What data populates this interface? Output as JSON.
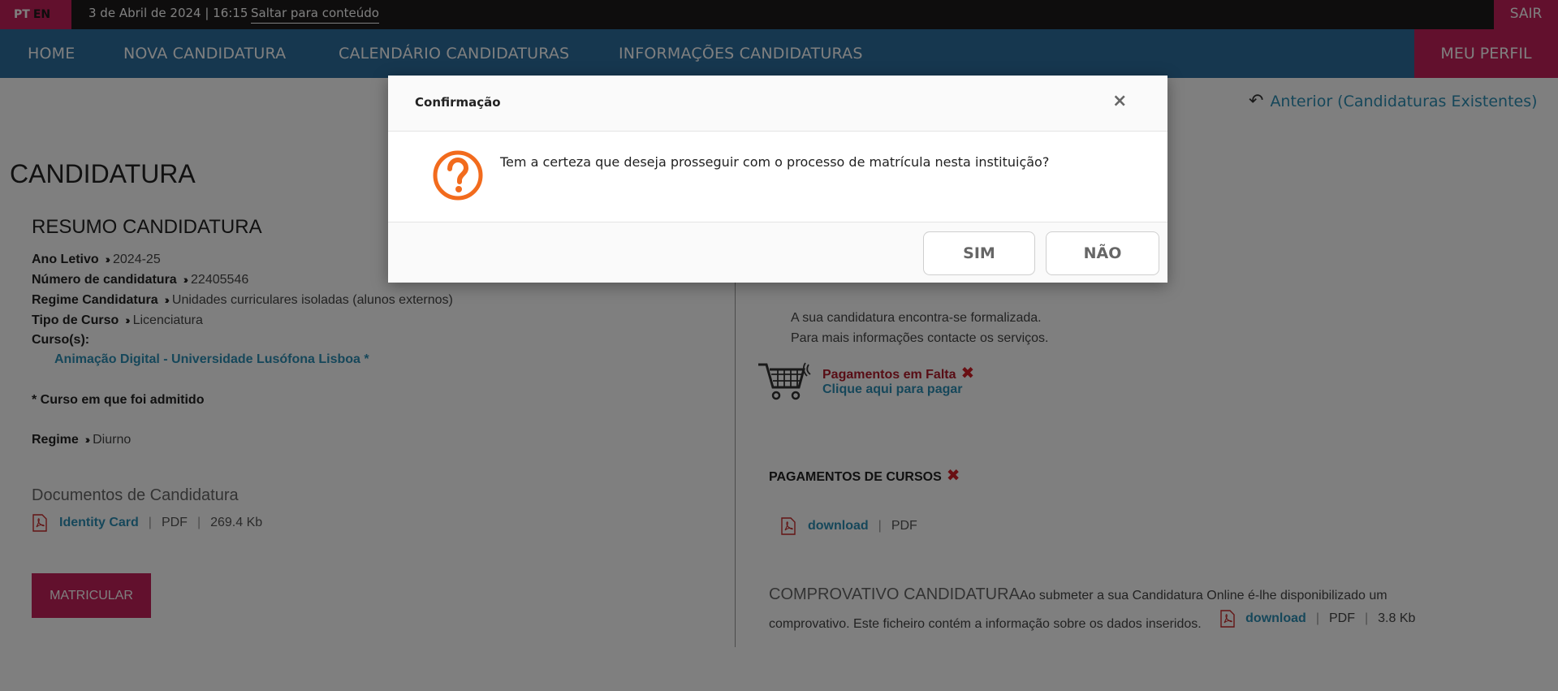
{
  "topbar": {
    "lang_pt": "PT",
    "lang_en": "EN",
    "datetime": "3 de Abril de 2024 | 16:15",
    "skip_link": "Saltar para conteúdo",
    "logout": "SAIR"
  },
  "nav": {
    "items": [
      {
        "label": "HOME"
      },
      {
        "label": "NOVA CANDIDATURA"
      },
      {
        "label": "CALENDÁRIO CANDIDATURAS"
      },
      {
        "label": "INFORMAÇÕES CANDIDATURAS"
      }
    ],
    "profile": "MEU PERFIL"
  },
  "main": {
    "back_link": "Anterior (Candidaturas Existentes)",
    "page_title": "CANDIDATURA",
    "summary_title": "RESUMO CANDIDATURA",
    "fields": [
      {
        "label": "Ano Letivo",
        "value": "2024-25"
      },
      {
        "label": "Número de candidatura",
        "value": "22405546"
      },
      {
        "label": "Regime Candidatura",
        "value": "Unidades curriculares isoladas (alunos externos)"
      },
      {
        "label": "Tipo de Curso",
        "value": "Licenciatura"
      }
    ],
    "courses_label": "Curso(s):",
    "course_link": "Animação Digital - Universidade Lusófona Lisboa *",
    "admitted_note": "* Curso em que foi admitido",
    "regime_label": "Regime",
    "regime_value": "Diurno",
    "docs_title": "Documentos de Candidatura",
    "doc_file": {
      "name": "Identity Card",
      "type": "PDF",
      "size": "269.4 Kb"
    },
    "enroll_button": "MATRICULAR"
  },
  "right": {
    "status_line1": "A sua candidatura encontra-se formalizada.",
    "status_line2": "Para mais informações contacte os serviços.",
    "missing_payments": "Pagamentos em Falta",
    "pay_link": "Clique aqui para pagar",
    "course_payments_title": "PAGAMENTOS DE CURSOS",
    "course_payment_file": {
      "name": "download",
      "type": "PDF"
    },
    "receipt_title": "COMPROVATIVO CANDIDATURA",
    "receipt_text": "Ao submeter a sua Candidatura Online é-lhe disponibilizado um comprovativo. Este ficheiro contém a informação sobre os dados inseridos.",
    "receipt_file": {
      "name": "download",
      "type": "PDF",
      "size": "3.8 Kb"
    }
  },
  "modal": {
    "title": "Confirmação",
    "close": "×",
    "message": "Tem a certeza que deseja prosseguir com o processo de matrícula nesta instituição?",
    "yes": "SIM",
    "no": "NÃO"
  },
  "colors": {
    "accent": "#c5215a",
    "nav_blue": "#2d6f9f",
    "link": "#2d8fb5",
    "question_orange": "#f26b1d"
  }
}
